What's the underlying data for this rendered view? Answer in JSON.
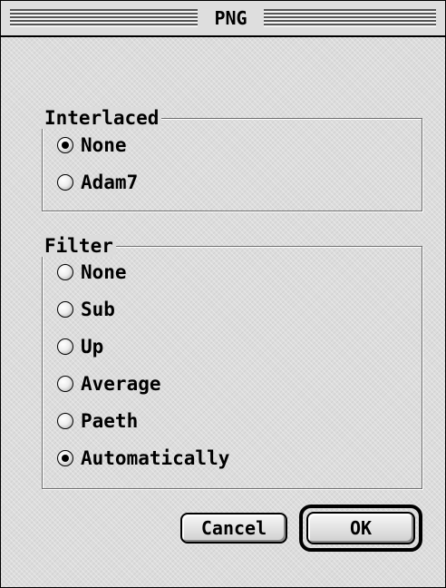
{
  "window": {
    "title": "PNG"
  },
  "interlaced": {
    "label": "Interlaced",
    "options": [
      {
        "label": "None",
        "selected": true
      },
      {
        "label": "Adam7",
        "selected": false
      }
    ]
  },
  "filter": {
    "label": "Filter",
    "options": [
      {
        "label": "None",
        "selected": false
      },
      {
        "label": "Sub",
        "selected": false
      },
      {
        "label": "Up",
        "selected": false
      },
      {
        "label": "Average",
        "selected": false
      },
      {
        "label": "Paeth",
        "selected": false
      },
      {
        "label": "Automatically",
        "selected": true
      }
    ]
  },
  "buttons": {
    "cancel_label": "Cancel",
    "ok_label": "OK",
    "default_button": "ok"
  },
  "icons": {
    "radio_selected": "radio-selected-icon",
    "radio_unselected": "radio-unselected-icon"
  }
}
